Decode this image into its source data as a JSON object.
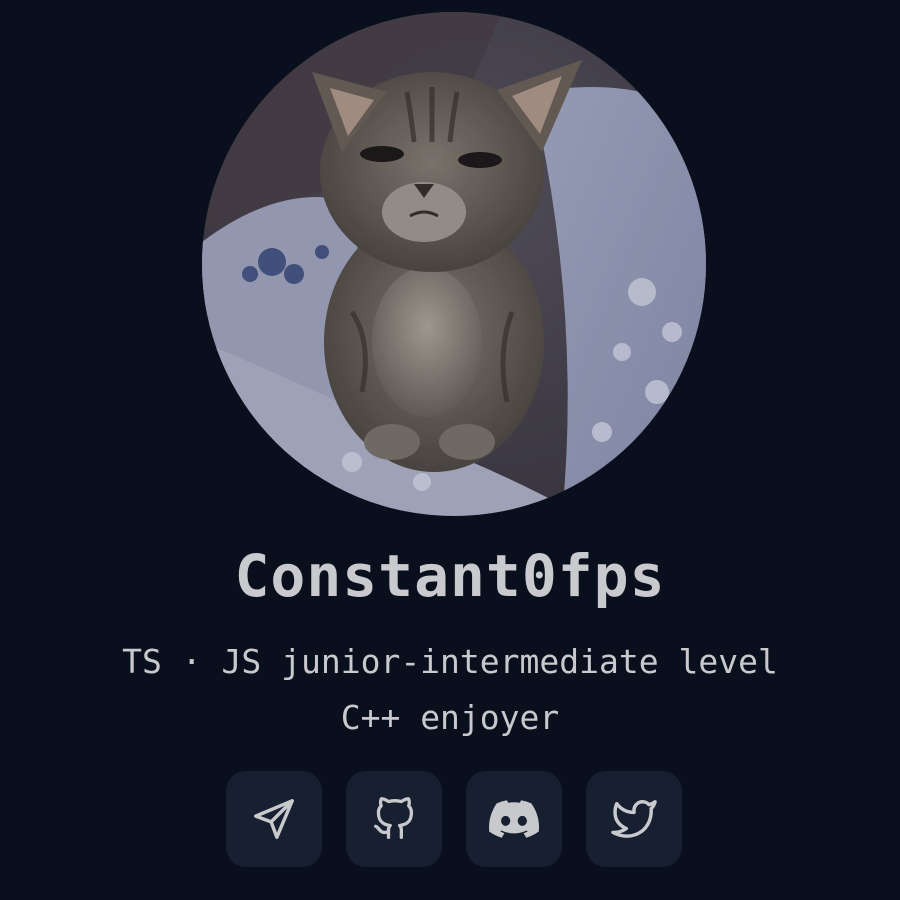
{
  "profile": {
    "username": "Constant0fps",
    "bio_line1": "TS · JS junior-intermediate level",
    "bio_line2": "C++ enjoyer",
    "avatar": "kitten-photo"
  },
  "socials": [
    {
      "icon": "telegram-send-icon"
    },
    {
      "icon": "github-icon"
    },
    {
      "icon": "discord-icon"
    },
    {
      "icon": "twitter-icon"
    }
  ],
  "colors": {
    "background": "#0a0f1d",
    "button_bg": "#162031",
    "text": "#c8c9cc",
    "icon": "#c8c9cc"
  }
}
